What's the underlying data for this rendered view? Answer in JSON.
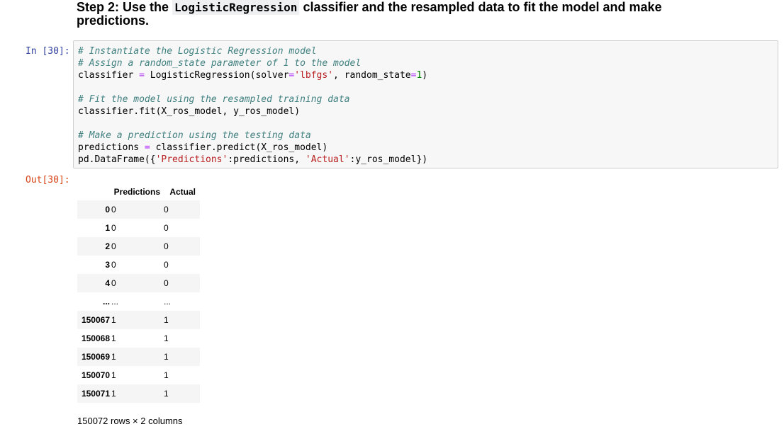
{
  "markdown": {
    "heading_prefix": "Step 2: Use the ",
    "heading_code": "LogisticRegression",
    "heading_suffix": " classifier and the resampled data to fit the model and make predictions."
  },
  "cell": {
    "in_prompt": "In [30]:",
    "out_prompt": "Out[30]:",
    "code_lines": [
      [
        {
          "t": "# Instantiate the Logistic Regression model",
          "k": "comment"
        }
      ],
      [
        {
          "t": "# Assign a random_state parameter of 1 to the model",
          "k": "comment"
        }
      ],
      [
        {
          "t": "classifier ",
          "k": ""
        },
        {
          "t": "=",
          "k": "op"
        },
        {
          "t": " LogisticRegression(solver",
          "k": ""
        },
        {
          "t": "=",
          "k": "op"
        },
        {
          "t": "'lbfgs'",
          "k": "str"
        },
        {
          "t": ", random_state",
          "k": ""
        },
        {
          "t": "=",
          "k": "op"
        },
        {
          "t": "1",
          "k": "num"
        },
        {
          "t": ")",
          "k": ""
        }
      ],
      [
        {
          "t": "",
          "k": ""
        }
      ],
      [
        {
          "t": "# Fit the model using the resampled training data",
          "k": "comment"
        }
      ],
      [
        {
          "t": "classifier.fit(X_ros_model, y_ros_model)",
          "k": ""
        }
      ],
      [
        {
          "t": "",
          "k": ""
        }
      ],
      [
        {
          "t": "# Make a prediction using the testing data",
          "k": "comment"
        }
      ],
      [
        {
          "t": "predictions ",
          "k": ""
        },
        {
          "t": "=",
          "k": "op"
        },
        {
          "t": " classifier.predict(X_ros_model)",
          "k": ""
        }
      ],
      [
        {
          "t": "pd.DataFrame({",
          "k": ""
        },
        {
          "t": "'Predictions'",
          "k": "str"
        },
        {
          "t": ":predictions, ",
          "k": ""
        },
        {
          "t": "'Actual'",
          "k": "str"
        },
        {
          "t": ":y_ros_model})",
          "k": ""
        }
      ]
    ]
  },
  "dataframe": {
    "columns": [
      "Predictions",
      "Actual"
    ],
    "rows": [
      {
        "index": "0",
        "values": [
          "0",
          "0"
        ]
      },
      {
        "index": "1",
        "values": [
          "0",
          "0"
        ]
      },
      {
        "index": "2",
        "values": [
          "0",
          "0"
        ]
      },
      {
        "index": "3",
        "values": [
          "0",
          "0"
        ]
      },
      {
        "index": "4",
        "values": [
          "0",
          "0"
        ]
      },
      {
        "index": "...",
        "values": [
          "...",
          "..."
        ]
      },
      {
        "index": "150067",
        "values": [
          "1",
          "1"
        ]
      },
      {
        "index": "150068",
        "values": [
          "1",
          "1"
        ]
      },
      {
        "index": "150069",
        "values": [
          "1",
          "1"
        ]
      },
      {
        "index": "150070",
        "values": [
          "1",
          "1"
        ]
      },
      {
        "index": "150071",
        "values": [
          "1",
          "1"
        ]
      }
    ],
    "dims_text": "150072 rows × 2 columns"
  },
  "colors": {
    "in_prompt": "#303f9f",
    "out_prompt": "#d84315",
    "code_bg": "#f7f7f7",
    "comment": "#408080",
    "string": "#ba2121",
    "operator": "#aa22ff",
    "number": "#008000"
  }
}
